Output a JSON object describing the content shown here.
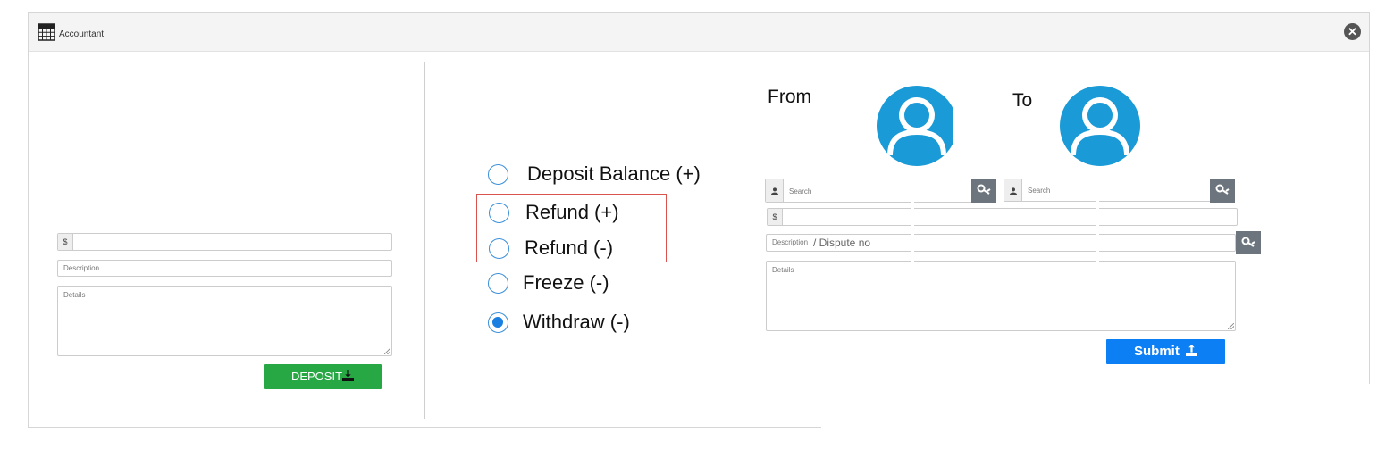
{
  "window": {
    "title": "Accountant",
    "title_icon": "calculator-icon",
    "close_icon": "close-icon"
  },
  "deposit_panel": {
    "amount_prefix": "$",
    "amount_value": "",
    "description_placeholder": "Description",
    "details_placeholder": "Details",
    "deposit_label": "DEPOSIT",
    "deposit_icon": "download-icon",
    "button_color": "#28a745"
  },
  "operations": {
    "options": [
      {
        "label": "Deposit Balance (+)",
        "checked": false
      },
      {
        "label": "Refund (+)",
        "checked": false
      },
      {
        "label": "Refund (-)",
        "checked": false
      },
      {
        "label": "Freeze (-)",
        "checked": false
      },
      {
        "label": "Withdraw (-)",
        "checked": true
      }
    ],
    "highlight_color": "#d9534f"
  },
  "transfer_panel": {
    "from_label": "From",
    "to_label": "To",
    "from_search_placeholder": "Search",
    "to_search_placeholder": "Search",
    "user_icon": "user-icon",
    "search_icon": "search-key-icon",
    "amount_prefix": "$",
    "description_placeholder": "Description",
    "description_hint": "/ Dispute no",
    "details_placeholder": "Details",
    "submit_label": "Submit",
    "submit_icon": "upload-icon",
    "avatar_color": "#1a9ad6",
    "submit_color": "#0d7ff5"
  }
}
